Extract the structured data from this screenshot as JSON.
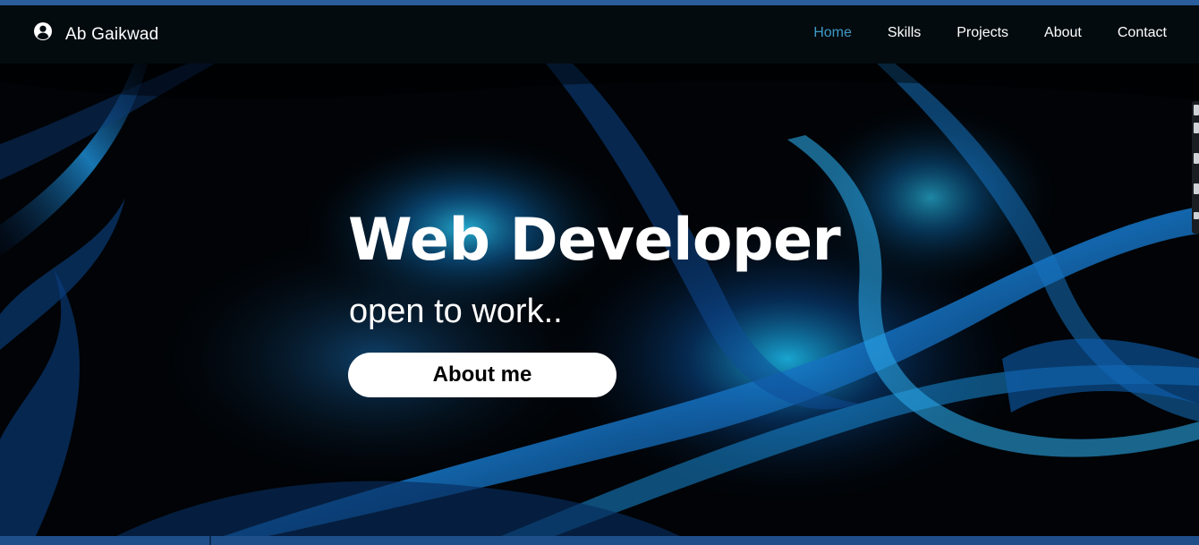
{
  "brand": {
    "name": "Ab Gaikwad",
    "icon": "user-circle-icon"
  },
  "nav": {
    "items": [
      {
        "label": "Home",
        "active": true
      },
      {
        "label": "Skills",
        "active": false
      },
      {
        "label": "Projects",
        "active": false
      },
      {
        "label": "About",
        "active": false
      },
      {
        "label": "Contact",
        "active": false
      }
    ]
  },
  "hero": {
    "title": "Web Developer",
    "subtitle": "open to work..",
    "button_label": "About me"
  },
  "colors": {
    "active_link": "#3f98c4",
    "navbar_bg": "#040b0f",
    "accent_blue": "#1e9bd8"
  }
}
